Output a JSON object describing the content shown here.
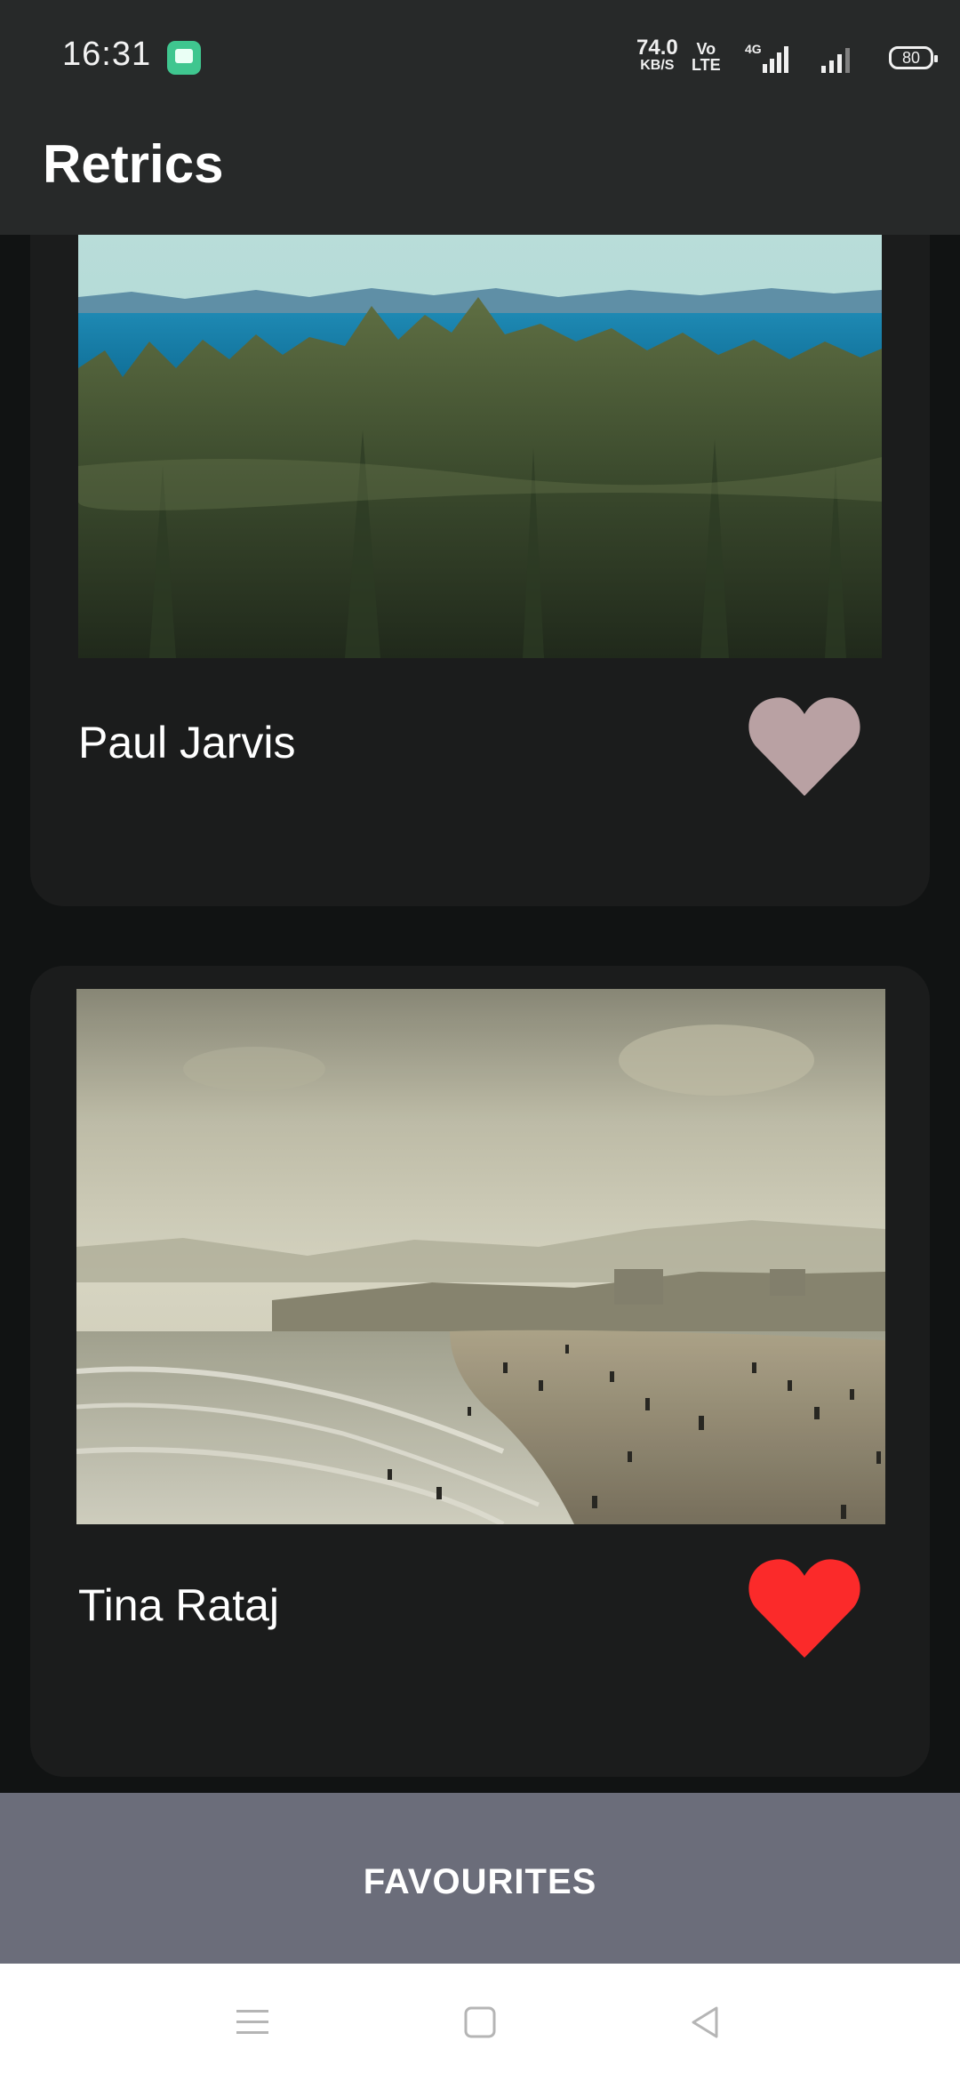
{
  "status_bar": {
    "time": "16:31",
    "net_speed": "74.0",
    "net_speed_unit": "KB/S",
    "volte_top": "Vo",
    "volte_bottom": "LTE",
    "network": "4G",
    "battery": "80",
    "app_icon": "chat-notification-icon"
  },
  "app_bar": {
    "title": "Retrics"
  },
  "photos": [
    {
      "author": "Paul Jarvis",
      "favourite": false,
      "heart_color": "#b9a1a3"
    },
    {
      "author": "Tina Rataj",
      "favourite": true,
      "heart_color": "#fb2a2a"
    }
  ],
  "bottom_button": {
    "label": "FAVOURITES"
  },
  "nav": {
    "icons": [
      "menu-icon",
      "home-icon",
      "back-icon"
    ]
  },
  "colors": {
    "background": "#111313",
    "card": "#1b1c1c",
    "toolbar": "#272929",
    "favourites_bar": "#6b6d7a"
  }
}
